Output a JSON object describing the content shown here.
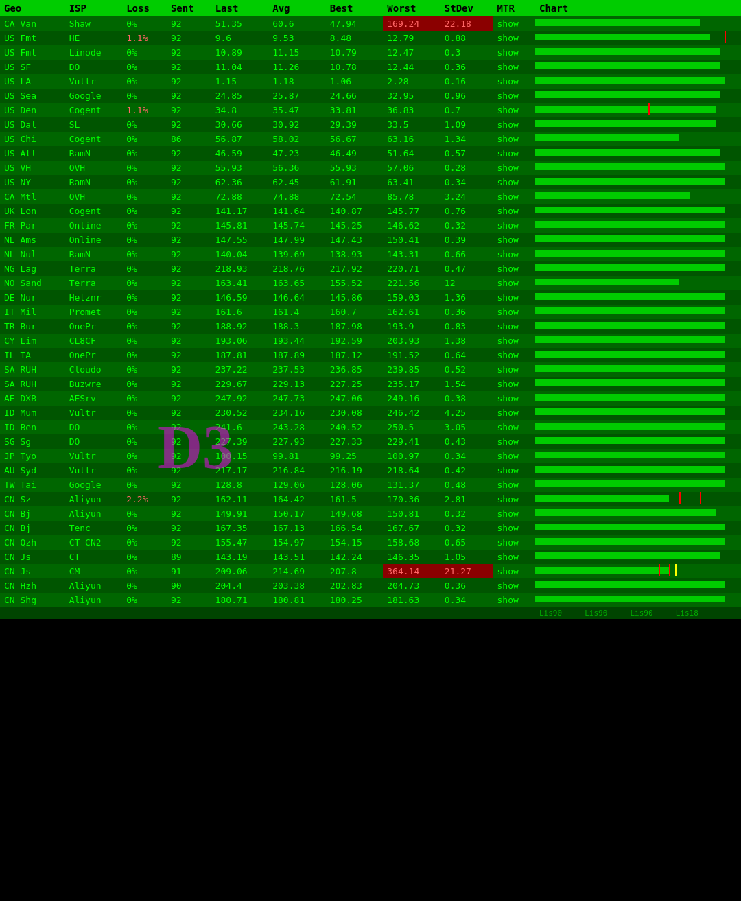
{
  "header": {
    "cols": [
      "Geo",
      "ISP",
      "Loss",
      "Sent",
      "Last",
      "Avg",
      "Best",
      "Worst",
      "StDev",
      "MTR",
      "Chart"
    ]
  },
  "footer": {
    "labels": [
      "Lis90",
      "Lis90",
      "Lis90",
      "Lis18"
    ]
  },
  "rows": [
    {
      "geo": "CA Van",
      "isp": "Shaw",
      "loss": "0%",
      "sent": "92",
      "last": "51.35",
      "avg": "60.6",
      "best": "47.94",
      "worst": "169.24",
      "stdev": "22.18",
      "mtr": "show",
      "worstHigh": true,
      "stdevHigh": true,
      "chartSpikes": [],
      "chartBar": 80
    },
    {
      "geo": "US Fmt",
      "isp": "HE",
      "loss": "1.1%",
      "sent": "92",
      "last": "9.6",
      "avg": "9.53",
      "best": "8.48",
      "worst": "12.79",
      "stdev": "0.88",
      "mtr": "show",
      "chartSpikes": [
        92
      ],
      "chartBar": 85
    },
    {
      "geo": "US Fmt",
      "isp": "Linode",
      "loss": "0%",
      "sent": "92",
      "last": "10.89",
      "avg": "11.15",
      "best": "10.79",
      "worst": "12.47",
      "stdev": "0.3",
      "mtr": "show",
      "chartSpikes": [],
      "chartBar": 90
    },
    {
      "geo": "US SF",
      "isp": "DO",
      "loss": "0%",
      "sent": "92",
      "last": "11.04",
      "avg": "11.26",
      "best": "10.78",
      "worst": "12.44",
      "stdev": "0.36",
      "mtr": "show",
      "chartSpikes": [],
      "chartBar": 90
    },
    {
      "geo": "US LA",
      "isp": "Vultr",
      "loss": "0%",
      "sent": "92",
      "last": "1.15",
      "avg": "1.18",
      "best": "1.06",
      "worst": "2.28",
      "stdev": "0.16",
      "mtr": "show",
      "chartSpikes": [],
      "chartBar": 92
    },
    {
      "geo": "US Sea",
      "isp": "Google",
      "loss": "0%",
      "sent": "92",
      "last": "24.85",
      "avg": "25.87",
      "best": "24.66",
      "worst": "32.95",
      "stdev": "0.96",
      "mtr": "show",
      "chartSpikes": [],
      "chartBar": 90
    },
    {
      "geo": "US Den",
      "isp": "Cogent",
      "loss": "1.1%",
      "sent": "92",
      "last": "34.8",
      "avg": "35.47",
      "best": "33.81",
      "worst": "36.83",
      "stdev": "0.7",
      "mtr": "show",
      "chartSpikes": [
        55
      ],
      "chartBar": 88
    },
    {
      "geo": "US Dal",
      "isp": "SL",
      "loss": "0%",
      "sent": "92",
      "last": "30.66",
      "avg": "30.92",
      "best": "29.39",
      "worst": "33.5",
      "stdev": "1.09",
      "mtr": "show",
      "chartSpikes": [],
      "chartBar": 88
    },
    {
      "geo": "US Chi",
      "isp": "Cogent",
      "loss": "0%",
      "sent": "86",
      "last": "56.87",
      "avg": "58.02",
      "best": "56.67",
      "worst": "63.16",
      "stdev": "1.34",
      "mtr": "show",
      "chartSpikes": [],
      "chartBar": 70
    },
    {
      "geo": "US Atl",
      "isp": "RamN",
      "loss": "0%",
      "sent": "92",
      "last": "46.59",
      "avg": "47.23",
      "best": "46.49",
      "worst": "51.64",
      "stdev": "0.57",
      "mtr": "show",
      "chartSpikes": [],
      "chartBar": 90
    },
    {
      "geo": "US VH",
      "isp": "OVH",
      "loss": "0%",
      "sent": "92",
      "last": "55.93",
      "avg": "56.36",
      "best": "55.93",
      "worst": "57.06",
      "stdev": "0.28",
      "mtr": "show",
      "chartSpikes": [],
      "chartBar": 92
    },
    {
      "geo": "US NY",
      "isp": "RamN",
      "loss": "0%",
      "sent": "92",
      "last": "62.36",
      "avg": "62.45",
      "best": "61.91",
      "worst": "63.41",
      "stdev": "0.34",
      "mtr": "show",
      "chartSpikes": [],
      "chartBar": 92
    },
    {
      "geo": "CA Mtl",
      "isp": "OVH",
      "loss": "0%",
      "sent": "92",
      "last": "72.88",
      "avg": "74.88",
      "best": "72.54",
      "worst": "85.78",
      "stdev": "3.24",
      "mtr": "show",
      "chartSpikes": [],
      "chartBar": 75
    },
    {
      "geo": "UK Lon",
      "isp": "Cogent",
      "loss": "0%",
      "sent": "92",
      "last": "141.17",
      "avg": "141.64",
      "best": "140.87",
      "worst": "145.77",
      "stdev": "0.76",
      "mtr": "show",
      "chartSpikes": [],
      "chartBar": 92
    },
    {
      "geo": "FR Par",
      "isp": "Online",
      "loss": "0%",
      "sent": "92",
      "last": "145.81",
      "avg": "145.74",
      "best": "145.25",
      "worst": "146.62",
      "stdev": "0.32",
      "mtr": "show",
      "chartSpikes": [],
      "chartBar": 92
    },
    {
      "geo": "NL Ams",
      "isp": "Online",
      "loss": "0%",
      "sent": "92",
      "last": "147.55",
      "avg": "147.99",
      "best": "147.43",
      "worst": "150.41",
      "stdev": "0.39",
      "mtr": "show",
      "chartSpikes": [],
      "chartBar": 92
    },
    {
      "geo": "NL Nul",
      "isp": "RamN",
      "loss": "0%",
      "sent": "92",
      "last": "140.04",
      "avg": "139.69",
      "best": "138.93",
      "worst": "143.31",
      "stdev": "0.66",
      "mtr": "show",
      "chartSpikes": [],
      "chartBar": 92
    },
    {
      "geo": "NG Lag",
      "isp": "Terra",
      "loss": "0%",
      "sent": "92",
      "last": "218.93",
      "avg": "218.76",
      "best": "217.92",
      "worst": "220.71",
      "stdev": "0.47",
      "mtr": "show",
      "chartSpikes": [],
      "chartBar": 92
    },
    {
      "geo": "NO Sand",
      "isp": "Terra",
      "loss": "0%",
      "sent": "92",
      "last": "163.41",
      "avg": "163.65",
      "best": "155.52",
      "worst": "221.56",
      "stdev": "12",
      "mtr": "show",
      "chartSpikes": [],
      "chartBar": 70
    },
    {
      "geo": "DE Nur",
      "isp": "Hetznr",
      "loss": "0%",
      "sent": "92",
      "last": "146.59",
      "avg": "146.64",
      "best": "145.86",
      "worst": "159.03",
      "stdev": "1.36",
      "mtr": "show",
      "chartSpikes": [],
      "chartBar": 92
    },
    {
      "geo": "IT Mil",
      "isp": "Promet",
      "loss": "0%",
      "sent": "92",
      "last": "161.6",
      "avg": "161.4",
      "best": "160.7",
      "worst": "162.61",
      "stdev": "0.36",
      "mtr": "show",
      "chartSpikes": [],
      "chartBar": 92
    },
    {
      "geo": "TR Bur",
      "isp": "OnePr",
      "loss": "0%",
      "sent": "92",
      "last": "188.92",
      "avg": "188.3",
      "best": "187.98",
      "worst": "193.9",
      "stdev": "0.83",
      "mtr": "show",
      "chartSpikes": [],
      "chartBar": 92
    },
    {
      "geo": "CY Lim",
      "isp": "CL8CF",
      "loss": "0%",
      "sent": "92",
      "last": "193.06",
      "avg": "193.44",
      "best": "192.59",
      "worst": "203.93",
      "stdev": "1.38",
      "mtr": "show",
      "chartSpikes": [],
      "chartBar": 92
    },
    {
      "geo": "IL TA",
      "isp": "OnePr",
      "loss": "0%",
      "sent": "92",
      "last": "187.81",
      "avg": "187.89",
      "best": "187.12",
      "worst": "191.52",
      "stdev": "0.64",
      "mtr": "show",
      "chartSpikes": [],
      "chartBar": 92
    },
    {
      "geo": "SA RUH",
      "isp": "Cloudo",
      "loss": "0%",
      "sent": "92",
      "last": "237.22",
      "avg": "237.53",
      "best": "236.85",
      "worst": "239.85",
      "stdev": "0.52",
      "mtr": "show",
      "chartSpikes": [],
      "chartBar": 92
    },
    {
      "geo": "SA RUH",
      "isp": "Buzwre",
      "loss": "0%",
      "sent": "92",
      "last": "229.67",
      "avg": "229.13",
      "best": "227.25",
      "worst": "235.17",
      "stdev": "1.54",
      "mtr": "show",
      "chartSpikes": [],
      "chartBar": 92
    },
    {
      "geo": "AE DXB",
      "isp": "AESrv",
      "loss": "0%",
      "sent": "92",
      "last": "247.92",
      "avg": "247.73",
      "best": "247.06",
      "worst": "249.16",
      "stdev": "0.38",
      "mtr": "show",
      "chartSpikes": [],
      "chartBar": 92
    },
    {
      "geo": "ID Mum",
      "isp": "Vultr",
      "loss": "0%",
      "sent": "92",
      "last": "230.52",
      "avg": "234.16",
      "best": "230.08",
      "worst": "246.42",
      "stdev": "4.25",
      "mtr": "show",
      "chartSpikes": [],
      "chartBar": 92
    },
    {
      "geo": "ID Ben",
      "isp": "DO",
      "loss": "0%",
      "sent": "92",
      "last": "241.6",
      "avg": "243.28",
      "best": "240.52",
      "worst": "250.5",
      "stdev": "3.05",
      "mtr": "show",
      "chartSpikes": [],
      "chartBar": 92
    },
    {
      "geo": "SG Sg",
      "isp": "DO",
      "loss": "0%",
      "sent": "92",
      "last": "227.39",
      "avg": "227.93",
      "best": "227.33",
      "worst": "229.41",
      "stdev": "0.43",
      "mtr": "show",
      "chartSpikes": [],
      "chartBar": 92
    },
    {
      "geo": "JP Tyo",
      "isp": "Vultr",
      "loss": "0%",
      "sent": "92",
      "last": "100.15",
      "avg": "99.81",
      "best": "99.25",
      "worst": "100.97",
      "stdev": "0.34",
      "mtr": "show",
      "chartSpikes": [],
      "chartBar": 92
    },
    {
      "geo": "AU Syd",
      "isp": "Vultr",
      "loss": "0%",
      "sent": "92",
      "last": "217.17",
      "avg": "216.84",
      "best": "216.19",
      "worst": "218.64",
      "stdev": "0.42",
      "mtr": "show",
      "chartSpikes": [],
      "chartBar": 92
    },
    {
      "geo": "TW Tai",
      "isp": "Google",
      "loss": "0%",
      "sent": "92",
      "last": "128.8",
      "avg": "129.06",
      "best": "128.06",
      "worst": "131.37",
      "stdev": "0.48",
      "mtr": "show",
      "chartSpikes": [],
      "chartBar": 92
    },
    {
      "geo": "CN Sz",
      "isp": "Aliyun",
      "loss": "2.2%",
      "sent": "92",
      "last": "162.11",
      "avg": "164.42",
      "best": "161.5",
      "worst": "170.36",
      "stdev": "2.81",
      "mtr": "show",
      "chartSpikes": [
        70,
        80
      ],
      "chartBar": 65
    },
    {
      "geo": "CN Bj",
      "isp": "Aliyun",
      "loss": "0%",
      "sent": "92",
      "last": "149.91",
      "avg": "150.17",
      "best": "149.68",
      "worst": "150.81",
      "stdev": "0.32",
      "mtr": "show",
      "chartSpikes": [],
      "chartBar": 88
    },
    {
      "geo": "CN Bj",
      "isp": "Tenc",
      "loss": "0%",
      "sent": "92",
      "last": "167.35",
      "avg": "167.13",
      "best": "166.54",
      "worst": "167.67",
      "stdev": "0.32",
      "mtr": "show",
      "chartSpikes": [],
      "chartBar": 92
    },
    {
      "geo": "CN Qzh",
      "isp": "CT CN2",
      "loss": "0%",
      "sent": "92",
      "last": "155.47",
      "avg": "154.97",
      "best": "154.15",
      "worst": "158.68",
      "stdev": "0.65",
      "mtr": "show",
      "chartSpikes": [],
      "chartBar": 92
    },
    {
      "geo": "CN Js",
      "isp": "CT",
      "loss": "0%",
      "sent": "89",
      "last": "143.19",
      "avg": "143.51",
      "best": "142.24",
      "worst": "146.35",
      "stdev": "1.05",
      "mtr": "show",
      "chartSpikes": [],
      "chartBar": 90
    },
    {
      "geo": "CN Js",
      "isp": "CM",
      "loss": "0%",
      "sent": "91",
      "last": "209.06",
      "avg": "214.69",
      "best": "207.8",
      "worst": "364.14",
      "stdev": "21.27",
      "mtr": "show",
      "worstHigh2": true,
      "stdevHigh2": true,
      "chartSpikes": [
        60,
        65
      ],
      "chartSpikesYellow": [
        68
      ],
      "chartBar": 65
    },
    {
      "geo": "CN Hzh",
      "isp": "Aliyun",
      "loss": "0%",
      "sent": "90",
      "last": "204.4",
      "avg": "203.38",
      "best": "202.83",
      "worst": "204.73",
      "stdev": "0.36",
      "mtr": "show",
      "chartSpikes": [],
      "chartBar": 92
    },
    {
      "geo": "CN Shg",
      "isp": "Aliyun",
      "loss": "0%",
      "sent": "92",
      "last": "180.71",
      "avg": "180.81",
      "best": "180.25",
      "worst": "181.63",
      "stdev": "0.34",
      "mtr": "show",
      "chartSpikes": [],
      "chartBar": 92
    }
  ]
}
